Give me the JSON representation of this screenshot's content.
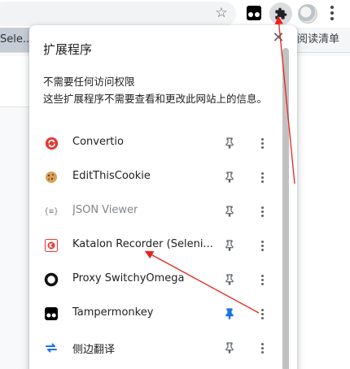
{
  "toolbar": {
    "star_icon": "star-outline-icon",
    "extension_icon": "tampermonkey-icon",
    "extensions_button_icon": "puzzle-icon",
    "profile_icon": "avatar",
    "menu_icon": "vertical-dots-icon"
  },
  "bookmarks": {
    "left_item": "Sele...",
    "reading_list": "阅读清单"
  },
  "popup": {
    "title": "扩展程序",
    "close_icon": "close-icon",
    "section_heading": "不需要任何访问权限",
    "section_desc": "这些扩展程序不需要查看和更改此网站上的信息。",
    "extensions": [
      {
        "name": "Convertio",
        "icon": "convertio-icon",
        "pinned": false,
        "disabled": false
      },
      {
        "name": "EditThisCookie",
        "icon": "cookie-icon",
        "pinned": false,
        "disabled": false
      },
      {
        "name": "JSON Viewer",
        "icon": "json-braces-icon",
        "pinned": false,
        "disabled": true
      },
      {
        "name": "Katalon Recorder (Seleni...",
        "icon": "katalon-icon",
        "pinned": false,
        "disabled": false
      },
      {
        "name": "Proxy SwitchyOmega",
        "icon": "ring-icon",
        "pinned": false,
        "disabled": false
      },
      {
        "name": "Tampermonkey",
        "icon": "tampermonkey-icon",
        "pinned": true,
        "disabled": false
      },
      {
        "name": "侧边翻译",
        "icon": "sync-arrows-icon",
        "pinned": false,
        "disabled": false
      }
    ]
  },
  "colors": {
    "pinned": "#1a73e8",
    "unpinned": "#5f6368",
    "annotation": "#e8231e",
    "convertio": "#e53935",
    "katalon": "#e53935",
    "translate": "#1a73e8"
  }
}
